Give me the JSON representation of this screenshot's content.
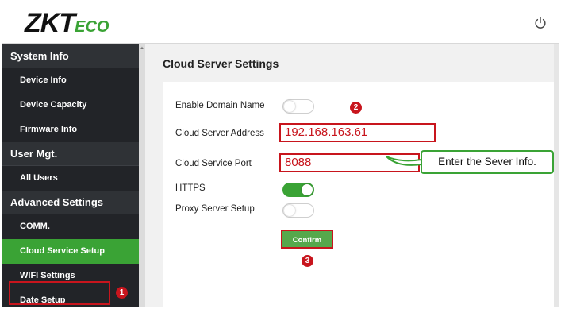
{
  "header": {
    "logo_zk": "ZK",
    "logo_t": "T",
    "logo_eco": "ECO",
    "power_icon": "power-icon"
  },
  "sidebar": {
    "groups": [
      {
        "label": "System Info",
        "items": [
          "Device Info",
          "Device Capacity",
          "Firmware Info"
        ]
      },
      {
        "label": "User Mgt.",
        "items": [
          "All Users"
        ]
      },
      {
        "label": "Advanced Settings",
        "items": [
          "COMM.",
          "Cloud Service Setup",
          "WIFI Settings",
          "Date Setup"
        ]
      }
    ],
    "active_item": "Cloud Service Setup"
  },
  "main": {
    "title": "Cloud Server Settings",
    "fields": {
      "enable_domain_label": "Enable Domain Name",
      "enable_domain_on": false,
      "server_address_label": "Cloud Server Address",
      "server_address_value": "192.168.163.61",
      "service_port_label": "Cloud Service Port",
      "service_port_value": "8088",
      "https_label": "HTTPS",
      "https_on": true,
      "proxy_label": "Proxy Server Setup",
      "proxy_on": false
    },
    "confirm_label": "Confirm"
  },
  "annotations": {
    "badge_1": "1",
    "badge_2": "2",
    "badge_3": "3",
    "callout_text": "Enter the Sever Info."
  },
  "colors": {
    "accent_green": "#3aa335",
    "annotation_red": "#c8151d",
    "sidebar_bg": "#222428"
  }
}
